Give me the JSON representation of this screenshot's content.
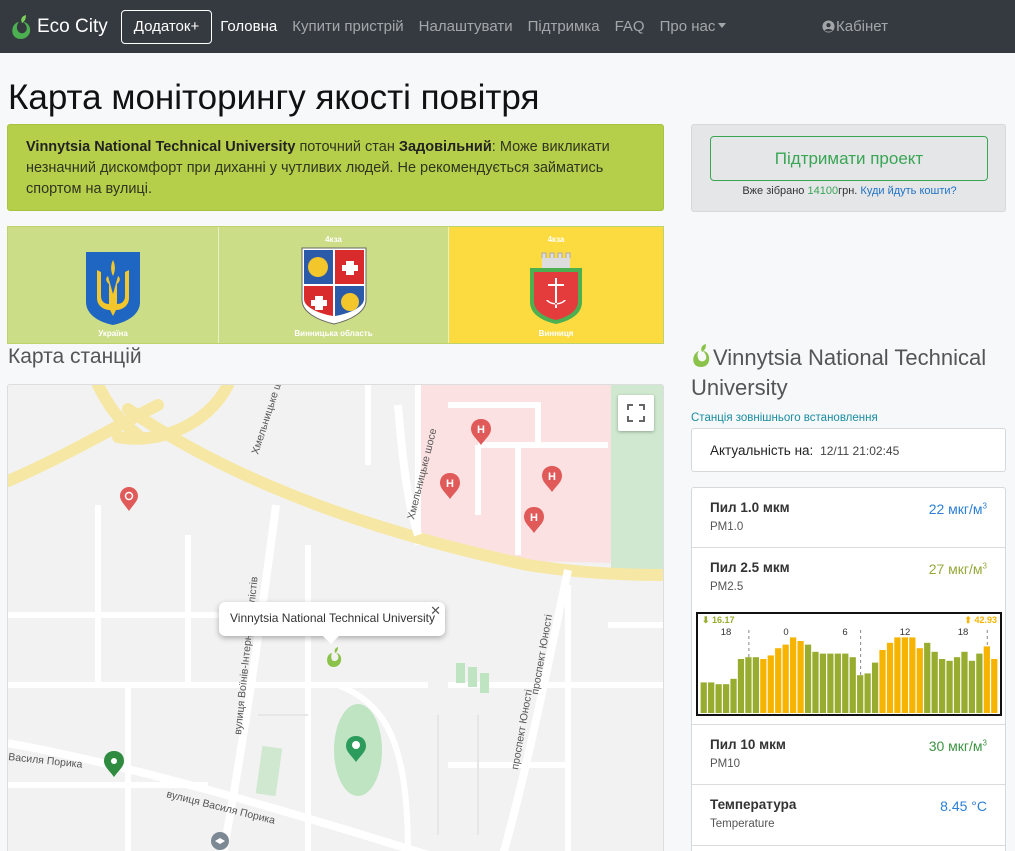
{
  "navbar": {
    "brand": "Eco City",
    "add_button": "Додаток+",
    "links": [
      "Головна",
      "Купити пристрій",
      "Налаштувати",
      "Підтримка",
      "FAQ",
      "Про нас"
    ],
    "cabinet": "Кабінет"
  },
  "page_title": "Карта моніторингу якості повітря",
  "status": {
    "station": "Vinnytsia National Technical University",
    "text_before": " поточний стан ",
    "level": "Задовільний",
    "text_after": ": Може викликати незначний дискомфорт при диханні у чутливих людей. Не рекомендується займатись спортом на вулиці."
  },
  "coats": [
    {
      "name": "Україна",
      "top": ""
    },
    {
      "name": "Винницька область",
      "top": "4кза"
    },
    {
      "name": "Винниця",
      "top": "4кза"
    }
  ],
  "stations_title": "Карта станцій",
  "map": {
    "popup": "Vinnytsia National Technical University",
    "streets": [
      "Хмельницьке шосе",
      "вулиця Воїнів-Інтернаціоналістів",
      "вулиця Василя Порика",
      "Василя Порика",
      "проспект Юності"
    ]
  },
  "support": {
    "button": "Підтримати проект",
    "collected_prefix": "Вже зібрано ",
    "amount": "14100",
    "currency": "грн.",
    "link": "Куди йдуть кошти?"
  },
  "station": {
    "title": "Vinnytsia National Technical University",
    "type": "Станція зовнішнього встановлення",
    "actual_label": "Актуальність на:",
    "actual_time": "12/11 21:02:45"
  },
  "metrics": [
    {
      "name": "Пил 1.0 мкм",
      "sub": "PM1.0",
      "value": "22 мкг/м",
      "color": "#2c7fd4"
    },
    {
      "name": "Пил 2.5 мкм",
      "sub": "PM2.5",
      "value": "27 мкг/м",
      "color": "#98a83a"
    },
    {
      "name": "Пил 10 мкм",
      "sub": "PM10",
      "value": "30 мкг/м",
      "color": "#3d9443"
    },
    {
      "name": "Температура",
      "sub": "Temperature",
      "value": "8.45 °C",
      "color": "#2c7fd4"
    }
  ],
  "chart_data": {
    "type": "bar",
    "min_label": "16.17",
    "max_label": "42.93",
    "tick_labels": [
      "18",
      "0",
      "6",
      "12",
      "18"
    ],
    "colors": {
      "green": "#98ad2f",
      "yellow": "#f6b400"
    },
    "values": [
      17,
      17,
      16,
      16,
      19,
      30,
      31,
      31,
      30,
      32,
      36,
      38,
      42,
      40,
      38,
      34,
      33,
      33,
      33,
      33,
      31,
      21,
      22,
      28,
      35,
      39,
      42,
      42,
      42,
      36,
      39,
      34,
      30,
      29,
      31,
      34,
      29,
      33,
      37,
      30
    ],
    "levels": [
      "g",
      "g",
      "g",
      "g",
      "g",
      "g",
      "g",
      "g",
      "y",
      "y",
      "y",
      "y",
      "y",
      "y",
      "g",
      "g",
      "g",
      "g",
      "g",
      "g",
      "g",
      "g",
      "g",
      "g",
      "y",
      "y",
      "y",
      "y",
      "y",
      "y",
      "g",
      "g",
      "g",
      "g",
      "g",
      "g",
      "g",
      "g",
      "y",
      "y"
    ]
  }
}
